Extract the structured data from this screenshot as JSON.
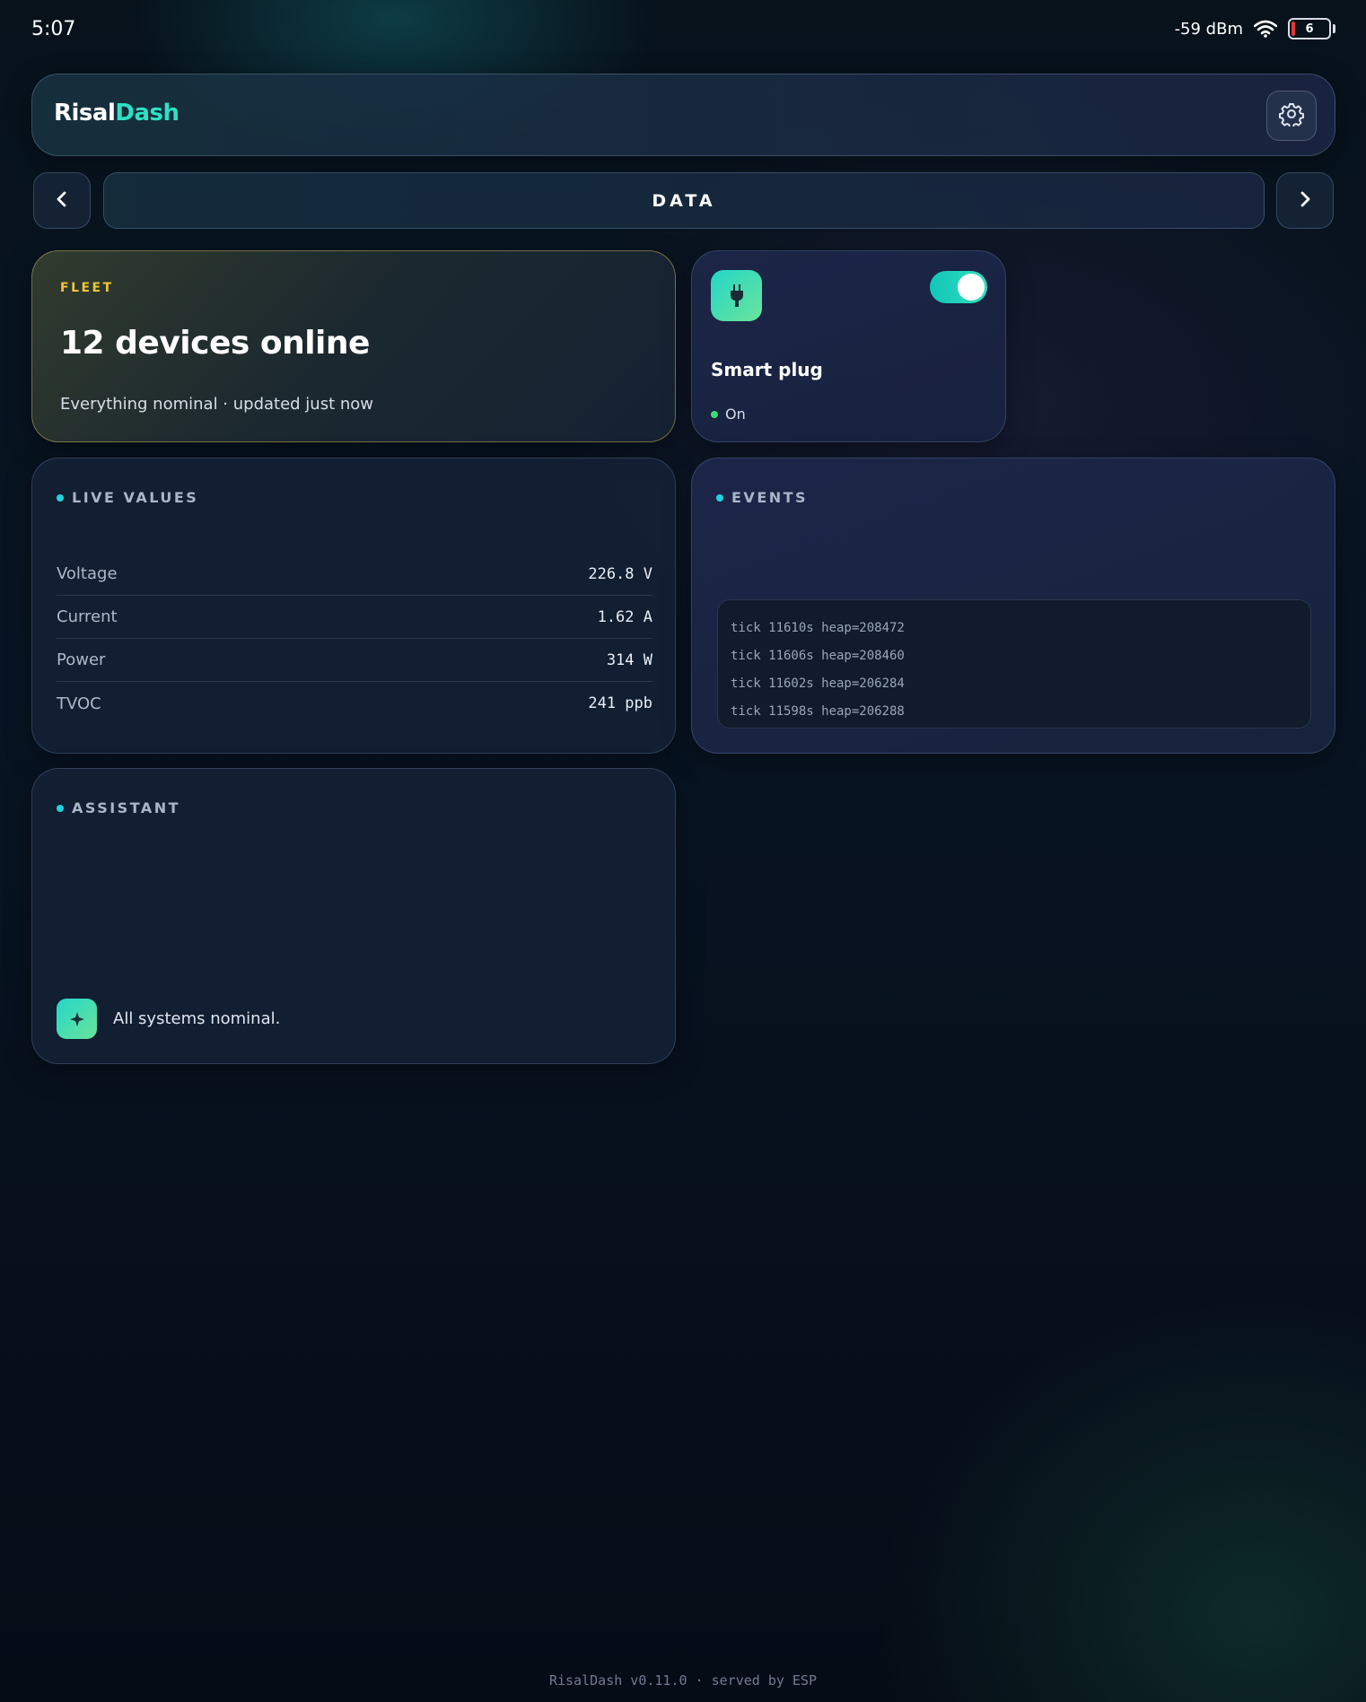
{
  "status_bar": {
    "time": "5:07",
    "signal": "-59 dBm",
    "battery_level": "6",
    "icons": [
      "wifi-icon",
      "battery-icon"
    ]
  },
  "header": {
    "brand_part1": "Risal",
    "brand_part2": "Dash",
    "settings_icon": "gear-icon"
  },
  "page_nav": {
    "title": "DATA",
    "prev_icon": "chevron-left-icon",
    "next_icon": "chevron-right-icon"
  },
  "fleet": {
    "label": "FLEET",
    "title": "12 devices online",
    "subtitle": "Everything nominal · updated just now"
  },
  "smart_plug": {
    "icon": "plug-icon",
    "name": "Smart plug",
    "state": "On",
    "toggle_on": true
  },
  "live_values": {
    "title": "LIVE VALUES",
    "rows": [
      {
        "label": "Voltage",
        "value": "226.8 V"
      },
      {
        "label": "Current",
        "value": "1.62 A"
      },
      {
        "label": "Power",
        "value": "314 W"
      },
      {
        "label": "TVOC",
        "value": "241 ppb"
      }
    ]
  },
  "events": {
    "title": "EVENTS",
    "lines": [
      "tick 11610s heap=208472",
      "tick 11606s heap=208460",
      "tick 11602s heap=206284",
      "tick 11598s heap=206288"
    ]
  },
  "assistant": {
    "title": "ASSISTANT",
    "icon": "sparkle-icon",
    "message": "All systems nominal."
  },
  "footer": {
    "text": "RisalDash v0.11.0 · served by ESP"
  },
  "colors": {
    "accent": "#2ee0c4",
    "fleet_label": "#f0c53a",
    "status_dot": "#3ddc7a",
    "section_dot": "#23d2e0"
  }
}
